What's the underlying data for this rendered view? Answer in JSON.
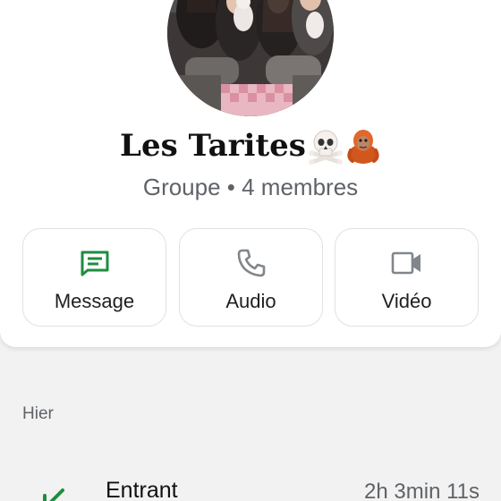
{
  "group": {
    "name": "Les Tarites",
    "emojis": [
      "skull-crossbones-icon",
      "orangutan-icon"
    ],
    "subtitle": "Groupe • 4 membres"
  },
  "actions": [
    {
      "label": "Message",
      "icon": "message-icon",
      "color": "#1e8e3e"
    },
    {
      "label": "Audio",
      "icon": "phone-icon",
      "color": "#80868b"
    },
    {
      "label": "Vidéo",
      "icon": "video-icon",
      "color": "#80868b"
    }
  ],
  "history": {
    "section_label": "Hier",
    "calls": [
      {
        "type": "Entrant",
        "duration": "2h 3min 11s",
        "icon": "incoming-call-arrow-icon",
        "color": "#1e8e3e"
      }
    ]
  }
}
